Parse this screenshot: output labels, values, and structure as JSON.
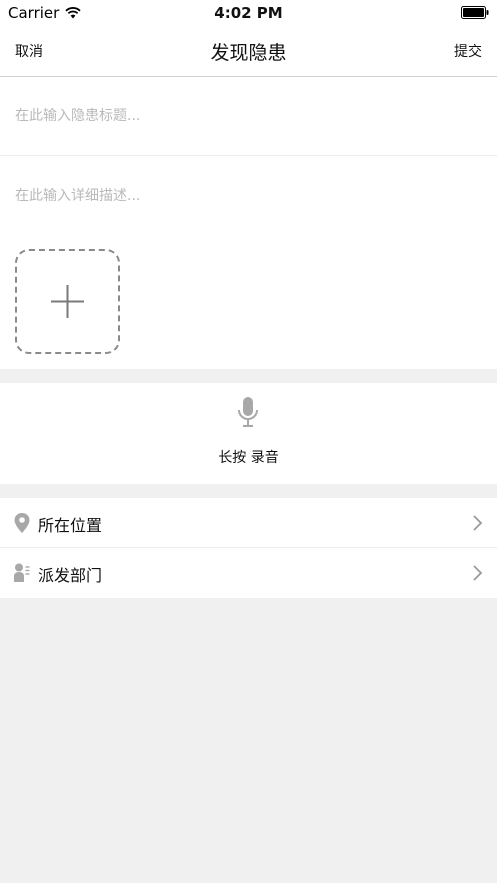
{
  "status_bar": {
    "carrier": "Carrier",
    "time": "4:02 PM"
  },
  "nav": {
    "cancel_label": "取消",
    "title": "发现隐患",
    "submit_label": "提交"
  },
  "form": {
    "title_placeholder": "在此输入隐患标题...",
    "description_placeholder": "在此输入详细描述..."
  },
  "recorder": {
    "label": "长按 录音"
  },
  "list": {
    "items": [
      {
        "label": "所在位置",
        "icon": "location-pin-icon"
      },
      {
        "label": "派发部门",
        "icon": "department-person-icon"
      }
    ]
  },
  "colors": {
    "background": "#f0f0f0",
    "surface": "#ffffff",
    "placeholder": "#b9b9b9",
    "icon_gray": "#a8a8a8",
    "dashed_border": "#8a8a8a"
  }
}
